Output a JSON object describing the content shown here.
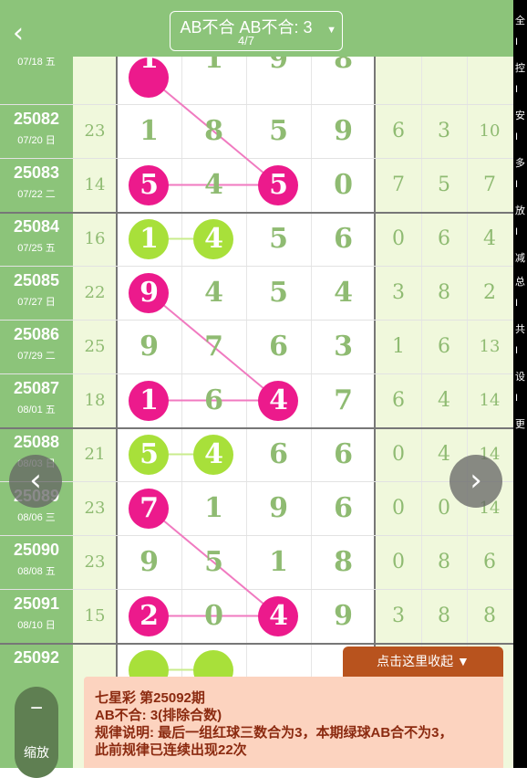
{
  "header": {
    "back_icon": "chevron-left-icon",
    "selector_title": "AB不合 AB不合: 3",
    "selector_page": "4/7",
    "selector_caret": "▼"
  },
  "status_strip": [
    "全",
    "I",
    "控",
    "I",
    "安",
    "I",
    "多",
    "I",
    "放",
    "I",
    "减",
    "总",
    "I",
    "共",
    "I",
    "设",
    "I",
    "更"
  ],
  "partial_row": {
    "date": "07/18 五",
    "numbers": [
      "1",
      "1",
      "9",
      "8"
    ]
  },
  "rows": [
    {
      "issue": "25082",
      "date": "07/20 日",
      "sum": "23",
      "numbers": [
        "1",
        "8",
        "5",
        "9"
      ],
      "right": [
        "6",
        "3",
        "10"
      ]
    },
    {
      "issue": "25083",
      "date": "07/22 二",
      "sum": "14",
      "numbers": [
        "5",
        "4",
        "5",
        "0"
      ],
      "right": [
        "7",
        "5",
        "7"
      ]
    },
    {
      "issue": "25084",
      "date": "07/25 五",
      "sum": "16",
      "numbers": [
        "1",
        "4",
        "5",
        "6"
      ],
      "right": [
        "0",
        "6",
        "4"
      ]
    },
    {
      "issue": "25085",
      "date": "07/27 日",
      "sum": "22",
      "numbers": [
        "9",
        "4",
        "5",
        "4"
      ],
      "right": [
        "3",
        "8",
        "2"
      ]
    },
    {
      "issue": "25086",
      "date": "07/29 二",
      "sum": "25",
      "numbers": [
        "9",
        "7",
        "6",
        "3"
      ],
      "right": [
        "1",
        "6",
        "13"
      ]
    },
    {
      "issue": "25087",
      "date": "08/01 五",
      "sum": "18",
      "numbers": [
        "1",
        "6",
        "4",
        "7"
      ],
      "right": [
        "6",
        "4",
        "14"
      ]
    },
    {
      "issue": "25088",
      "date": "08/03 日",
      "sum": "21",
      "numbers": [
        "5",
        "4",
        "6",
        "6"
      ],
      "right": [
        "0",
        "4",
        "14"
      ]
    },
    {
      "issue": "25089",
      "date": "08/06 三",
      "sum": "23",
      "numbers": [
        "7",
        "1",
        "9",
        "6"
      ],
      "right": [
        "0",
        "0",
        "14"
      ]
    },
    {
      "issue": "25090",
      "date": "08/08 五",
      "sum": "23",
      "numbers": [
        "9",
        "5",
        "1",
        "8"
      ],
      "right": [
        "0",
        "8",
        "6"
      ]
    },
    {
      "issue": "25091",
      "date": "08/10 日",
      "sum": "15",
      "numbers": [
        "2",
        "0",
        "4",
        "9"
      ],
      "right": [
        "3",
        "8",
        "8"
      ]
    },
    {
      "issue": "25092",
      "date": "",
      "sum": "",
      "numbers": [
        "",
        "",
        "",
        ""
      ],
      "right": [
        "",
        "",
        ""
      ]
    }
  ],
  "colors": {
    "green_header": "#8cc47a",
    "red_ball": "#ec1a8c",
    "green_ball": "#a8e03a",
    "number_green": "#8fbb72",
    "collapse_brown": "#b8531e",
    "panel_bg": "#fcd3bf",
    "panel_text": "#8b2a10"
  },
  "nav": {
    "prev_icon": "chevron-left-icon",
    "next_icon": "chevron-right-icon"
  },
  "collapse_label": "点击这里收起 ▼",
  "info": {
    "line1": "七星彩 第25092期",
    "line2": "AB不合: 3(排除合数)",
    "line3": "规律说明: 最后一组红球三数合为3，本期绿球AB合不为3，",
    "line4": "此前规律已连续出现22次"
  },
  "zoom": {
    "minus": "−",
    "label": "缩放"
  }
}
